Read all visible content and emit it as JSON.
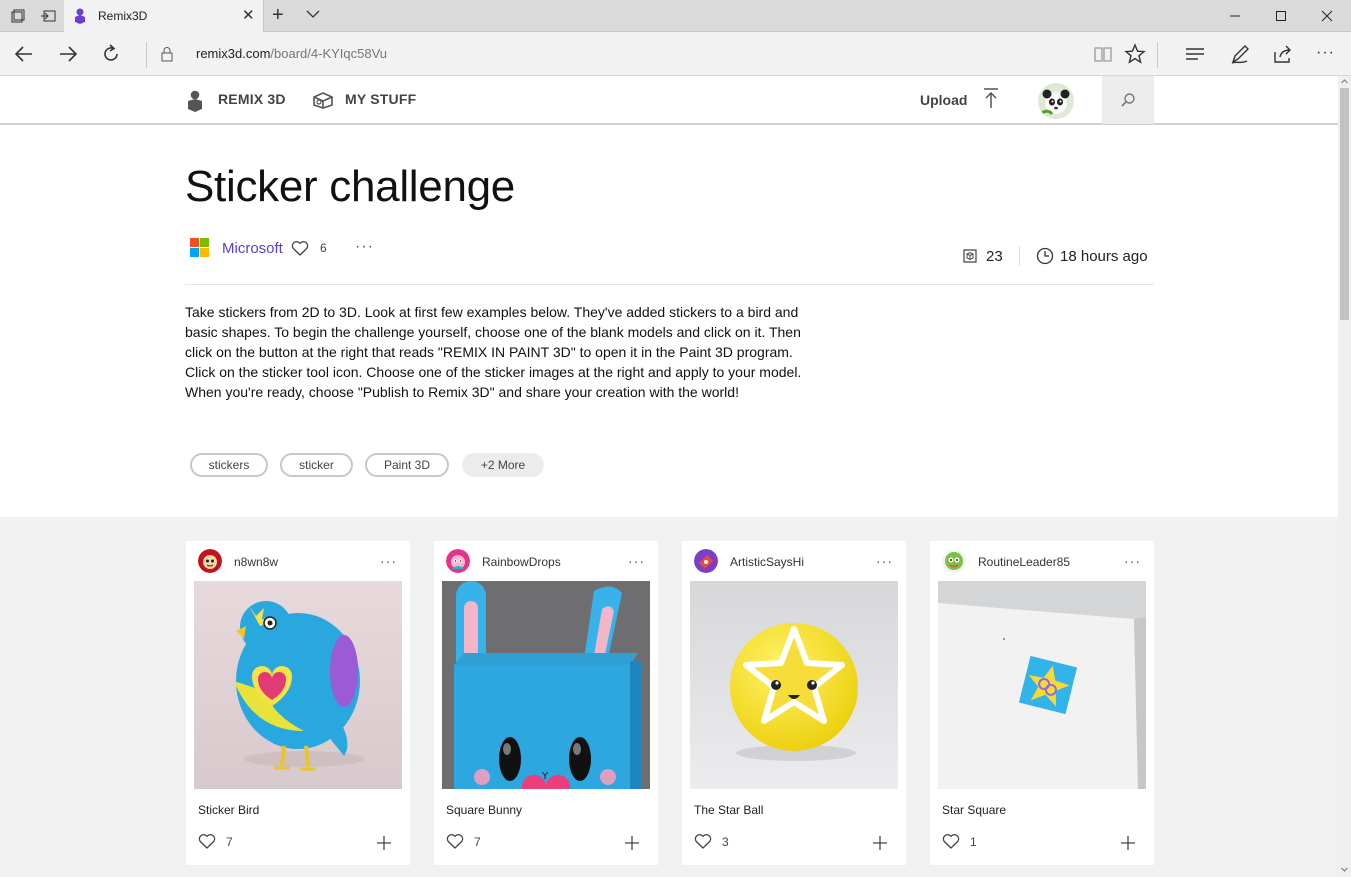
{
  "browser": {
    "tab_title": "Remix3D",
    "url_host": "remix3d.com",
    "url_path": "/board/4-KYIqc58Vu"
  },
  "site_header": {
    "brand_label": "REMIX 3D",
    "mystuff_label": "MY STUFF",
    "upload_label": "Upload"
  },
  "board": {
    "title": "Sticker challenge",
    "owner": "Microsoft",
    "owner_likes": "6",
    "more": "···",
    "model_count": "23",
    "time_ago": "18 hours ago",
    "description": "Take stickers from 2D to 3D. Look at first few examples below. They've added stickers to a bird and basic shapes. To begin the challenge yourself, choose one of the blank models and click on it. Then click on the button at the right that reads \"REMIX IN PAINT 3D\" to open it in the Paint 3D program. Click on the sticker tool icon. Choose one of the sticker images at the right and apply to your model. When you're ready, choose \"Publish to Remix 3D\" and share your creation with the world!",
    "tags": [
      "stickers",
      "sticker",
      "Paint 3D"
    ],
    "more_tags": "+2 More"
  },
  "cards": [
    {
      "user": "n8wn8w",
      "title": "Sticker Bird",
      "likes": "7",
      "more": "···"
    },
    {
      "user": "RainbowDrops",
      "title": "Square Bunny",
      "likes": "7",
      "more": "···"
    },
    {
      "user": "ArtisticSaysHi",
      "title": "The Star Ball",
      "likes": "3",
      "more": "···"
    },
    {
      "user": "RoutineLeader85",
      "title": "Star Square",
      "likes": "1",
      "more": "···"
    }
  ],
  "colors": {
    "owner_link": "#5b3fc4",
    "brand_purple": "#6b3fd4",
    "grid_background": "#f1f1f1"
  },
  "icons": [
    "restore-tabs-icon",
    "tab-aside-icon",
    "remix3d-favicon",
    "close-icon",
    "plus-icon",
    "chevron-down-icon",
    "back-icon",
    "forward-icon",
    "refresh-icon",
    "lock-icon",
    "reading-view-icon",
    "favorite-star-icon",
    "hub-icon",
    "pen-icon",
    "share-icon",
    "more-icon",
    "remix3d-logo-icon",
    "mystuff-icon",
    "upload-icon",
    "search-icon",
    "microsoft-logo-icon",
    "heart-icon",
    "model-count-icon",
    "clock-icon"
  ]
}
